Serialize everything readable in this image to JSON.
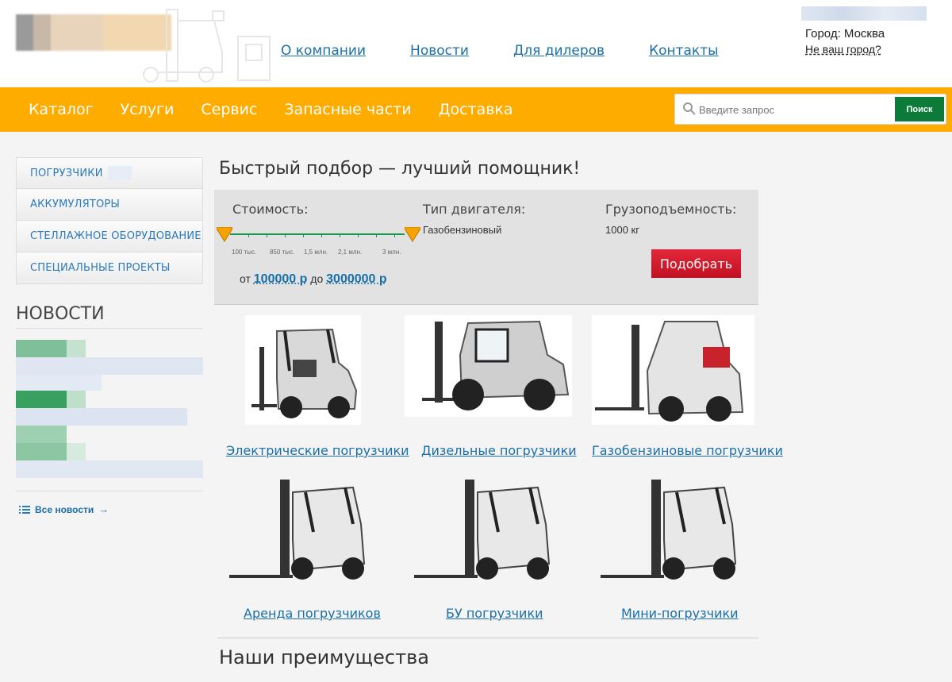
{
  "header": {
    "nav": [
      "О компании",
      "Новости",
      "Для дилеров",
      "Контакты"
    ],
    "city": "Город: Москва",
    "city_change": "Не ваш город?"
  },
  "menubar": {
    "items": [
      "Каталог",
      "Услуги",
      "Сервис",
      "Запасные части",
      "Доставка"
    ],
    "search_placeholder": "Введите запрос",
    "search_button": "Поиск"
  },
  "sidebar": {
    "items": [
      "ПОГРУЗЧИКИ",
      "АККУМУЛЯТОРЫ",
      "СТЕЛЛАЖНОЕ ОБОРУДОВАНИЕ",
      "СПЕЦИАЛЬНЫЕ ПРОЕКТЫ"
    ],
    "news_title": "НОВОСТИ",
    "all_news": "Все новости",
    "all_news_arrow": "→"
  },
  "quick": {
    "title": "Быстрый подбор — лучший помощник!",
    "cost_label": "Стоимость:",
    "engine_label": "Тип двигателя:",
    "engine_value": "Газобензиновый",
    "capacity_label": "Грузоподъемность:",
    "capacity_value": "1000 кг",
    "ticks": [
      "100 тыс.",
      "850 тыс.",
      "1,5 млн.",
      "2,1 млн.",
      "3 млн."
    ],
    "range_from_label": "от",
    "range_from": "100000 р",
    "range_to_label": "до",
    "range_to": "3000000 р",
    "pick_button": "Подобрать"
  },
  "categories": [
    "Электрические погрузчики",
    "Дизельные погрузчики",
    "Газобензиновые погрузчики",
    "Аренда погрузчиков",
    "БУ погрузчики",
    "Мини-погрузчики"
  ],
  "advantages_title": "Наши преимущества",
  "colors": {
    "accent": "#ffac00",
    "search_button": "#0c7a38",
    "pick_button": "#d41a2c",
    "link": "#1a6fa8"
  }
}
